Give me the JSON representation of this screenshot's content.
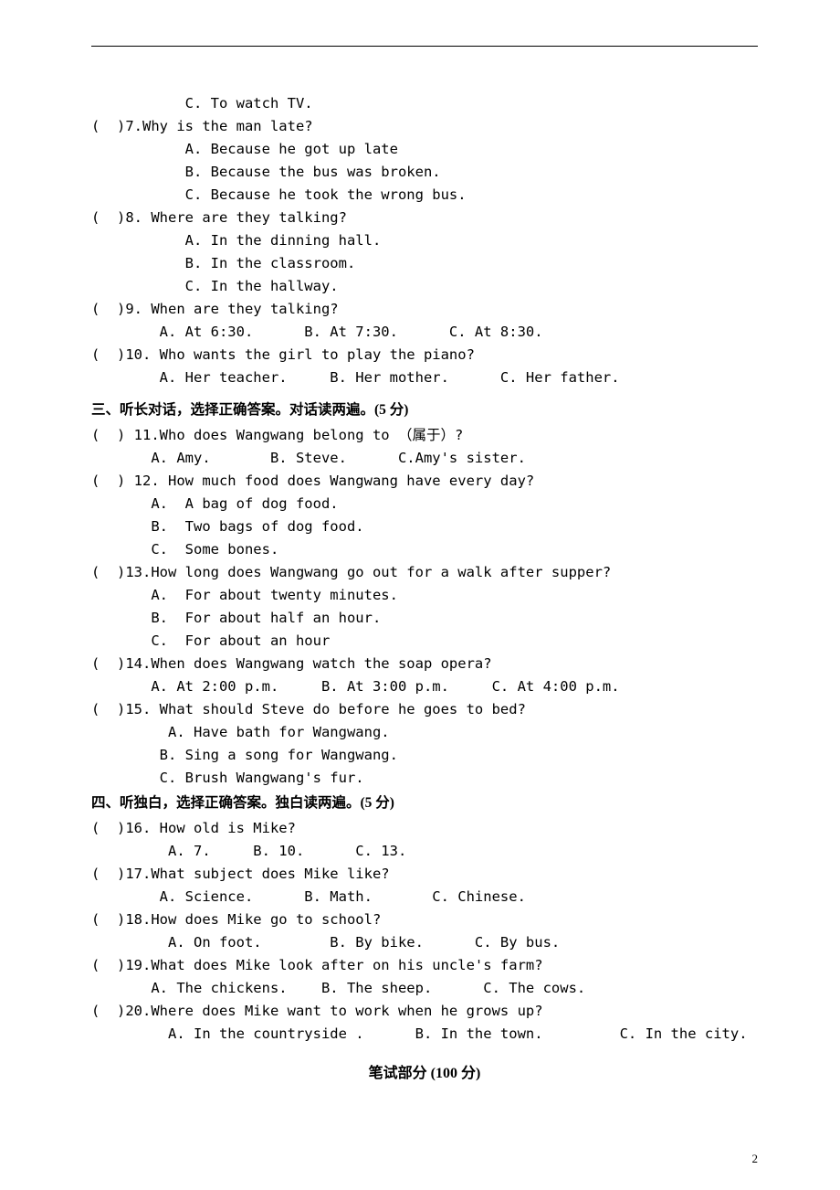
{
  "hr_present": true,
  "q6": {
    "optC": "           C. To watch TV."
  },
  "q7": {
    "stem": "(  )7.Why is the man late?",
    "optA": "           A. Because he got up late",
    "optB": "           B. Because the bus was broken.",
    "optC": "           C. Because he took the wrong bus."
  },
  "q8": {
    "stem": "(  )8. Where are they talking?",
    "optA": "           A. In the dinning hall.",
    "optB": "           B. In the classroom.",
    "optC": "           C. In the hallway."
  },
  "q9": {
    "stem": "(  )9. When are they talking?",
    "opts": "        A. At 6:30.      B. At 7:30.      C. At 8:30."
  },
  "q10": {
    "stem": "(  )10. Who wants the girl to play the piano?",
    "opts": "        A. Her teacher.     B. Her mother.      C. Her father."
  },
  "section3": "三、听长对话，选择正确答案。对话读两遍。(5 分)",
  "q11": {
    "stem": "(  ) 11.Who does Wangwang belong to （属于）?",
    "opts": "       A. Amy.       B. Steve.      C.Amy's sister."
  },
  "q12": {
    "stem": "(  ) 12. How much food does Wangwang have every day?",
    "optA": "       A.  A bag of dog food.",
    "optB": "       B.  Two bags of dog food.",
    "optC": "       C.  Some bones."
  },
  "q13": {
    "stem": "(  )13.How long does Wangwang go out for a walk after supper?",
    "optA": "       A.  For about twenty minutes.",
    "optB": "       B.  For about half an hour.",
    "optC": "       C.  For about an hour"
  },
  "q14": {
    "stem": "(  )14.When does Wangwang watch the soap opera?",
    "opts": "       A. At 2:00 p.m.     B. At 3:00 p.m.     C. At 4:00 p.m."
  },
  "q15": {
    "stem": "(  )15. What should Steve do before he goes to bed?",
    "optA": "         A. Have bath for Wangwang.",
    "optB": "        B. Sing a song for Wangwang.",
    "optC": "        C. Brush Wangwang's fur."
  },
  "section4": "四、听独白，选择正确答案。独白读两遍。(5 分)",
  "q16": {
    "stem": "(  )16. How old is Mike?",
    "opts": "         A. 7.     B. 10.      C. 13."
  },
  "q17": {
    "stem": "(  )17.What subject does Mike like?",
    "opts": "        A. Science.      B. Math.       C. Chinese."
  },
  "q18": {
    "stem": "(  )18.How does Mike go to school?",
    "opts": "         A. On foot.        B. By bike.      C. By bus."
  },
  "q19": {
    "stem": "(  )19.What does Mike look after on his uncle's farm?",
    "opts": "       A. The chickens.    B. The sheep.      C. The cows."
  },
  "q20": {
    "stem": "(  )20.Where does Mike want to work when he grows up?",
    "opts": "         A. In the countryside .      B. In the town.         C. In the city."
  },
  "written_title": "笔试部分 (100 分)",
  "pagenum": "2"
}
